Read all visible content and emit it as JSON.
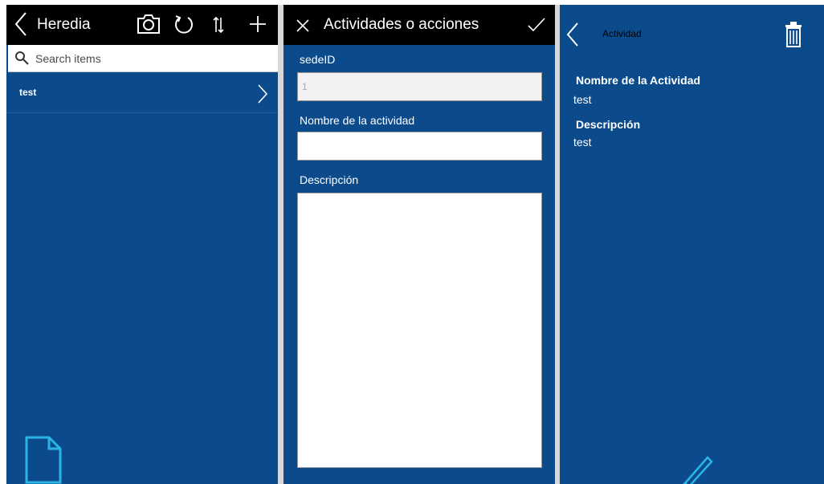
{
  "list_screen": {
    "title": "Heredia",
    "search": {
      "placeholder": "Search items",
      "value": ""
    },
    "items": [
      {
        "label": "test"
      }
    ],
    "icons": {
      "back": "chevron-left-icon",
      "camera": "camera-icon",
      "refresh": "refresh-icon",
      "sort": "sort-icon",
      "add": "plus-icon",
      "chevron": "chevron-right-icon",
      "document": "document-icon"
    }
  },
  "edit_screen": {
    "title": "Actividades o acciones",
    "fields": {
      "sede_id": {
        "label": "sedeID",
        "value": "1"
      },
      "nombre": {
        "label": "Nombre de la actividad",
        "value": ""
      },
      "descripcion": {
        "label": "Descripción",
        "value": ""
      }
    },
    "icons": {
      "cancel": "close-icon",
      "submit": "checkmark-icon"
    }
  },
  "detail_screen": {
    "title": "Actividad",
    "fields": [
      {
        "label": "Nombre de la Actividad",
        "value": "test"
      },
      {
        "label": "Descripción",
        "value": "test"
      }
    ],
    "icons": {
      "back": "chevron-left-icon",
      "delete": "trash-icon",
      "edit": "pencil-icon"
    }
  },
  "colors": {
    "background": "#0b4a8b",
    "header": "#000000",
    "divider": "#d7d7d7",
    "accent_icon": "#2bb4e6"
  }
}
